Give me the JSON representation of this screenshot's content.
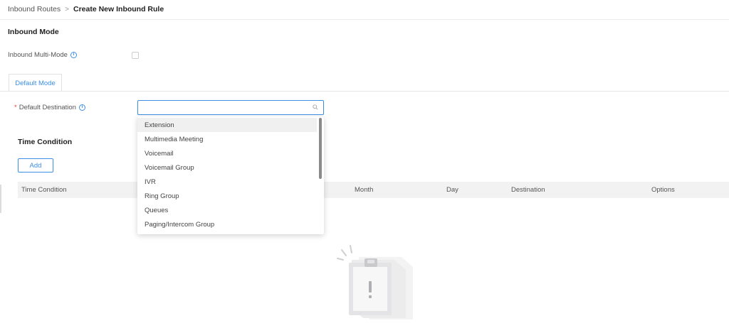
{
  "breadcrumb": {
    "parent": "Inbound Routes",
    "separator": ">",
    "current": "Create New Inbound Rule"
  },
  "inbound_mode": {
    "title": "Inbound Mode",
    "multi_mode_label": "Inbound Multi-Mode",
    "multi_mode_checked": false
  },
  "tabs": [
    {
      "label": "Default Mode",
      "active": true
    }
  ],
  "default_destination": {
    "label": "Default Destination",
    "required_mark": "*",
    "value": "",
    "placeholder": ""
  },
  "dropdown": {
    "options": [
      {
        "label": "Extension"
      },
      {
        "label": "Multimedia Meeting"
      },
      {
        "label": "Voicemail"
      },
      {
        "label": "Voicemail Group"
      },
      {
        "label": "IVR"
      },
      {
        "label": "Ring Group"
      },
      {
        "label": "Queues"
      },
      {
        "label": "Paging/Intercom Group"
      }
    ],
    "highlighted": "Extension"
  },
  "time_condition": {
    "title": "Time Condition",
    "add_label": "Add",
    "columns": [
      "Time Condition",
      "Month",
      "Day",
      "Destination",
      "Options"
    ]
  },
  "icons": {
    "info": "info-icon",
    "search": "search-icon",
    "empty_state": "empty-document-warning-illustration"
  },
  "colors": {
    "accent": "#3b8fe4",
    "required": "#e8453c",
    "table_header_bg": "#f2f2f2"
  }
}
